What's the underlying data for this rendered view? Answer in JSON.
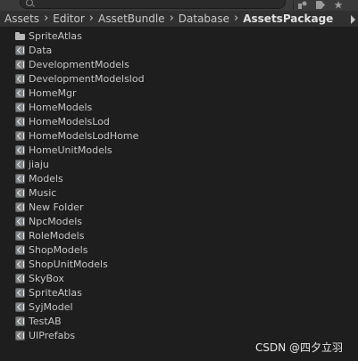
{
  "breadcrumb": {
    "items": [
      "Assets",
      "Editor",
      "AssetBundle",
      "Database",
      "AssetsPackage"
    ],
    "separator": "›"
  },
  "toolbar": {
    "search_placeholder": "",
    "icons": [
      "search-icon",
      "filter-by-type-icon",
      "filter-by-label-icon",
      "favorite-star-icon"
    ]
  },
  "folders": [
    {
      "label": "SpriteAtlas",
      "icon": "folder-icon"
    },
    {
      "label": "Data",
      "icon": "asset-bundle-folder-icon"
    },
    {
      "label": "DevelopmentModels",
      "icon": "asset-bundle-folder-icon"
    },
    {
      "label": "DevelopmentModelslod",
      "icon": "asset-bundle-folder-icon"
    },
    {
      "label": "HomeMgr",
      "icon": "asset-bundle-folder-icon"
    },
    {
      "label": "HomeModels",
      "icon": "asset-bundle-folder-icon"
    },
    {
      "label": "HomeModelsLod",
      "icon": "asset-bundle-folder-icon"
    },
    {
      "label": "HomeModelsLodHome",
      "icon": "asset-bundle-folder-icon"
    },
    {
      "label": "HomeUnitModels",
      "icon": "asset-bundle-folder-icon"
    },
    {
      "label": "jiaju",
      "icon": "asset-bundle-folder-icon"
    },
    {
      "label": "Models",
      "icon": "asset-bundle-folder-icon"
    },
    {
      "label": "Music",
      "icon": "asset-bundle-folder-icon"
    },
    {
      "label": "New Folder",
      "icon": "asset-bundle-folder-icon"
    },
    {
      "label": "NpcModels",
      "icon": "asset-bundle-folder-icon"
    },
    {
      "label": "RoleModels",
      "icon": "asset-bundle-folder-icon"
    },
    {
      "label": "ShopModels",
      "icon": "asset-bundle-folder-icon"
    },
    {
      "label": "ShopUnitModels",
      "icon": "asset-bundle-folder-icon"
    },
    {
      "label": "SkyBox",
      "icon": "asset-bundle-folder-icon"
    },
    {
      "label": "SpriteAtlas",
      "icon": "asset-bundle-folder-icon"
    },
    {
      "label": "SyjModel",
      "icon": "asset-bundle-folder-icon"
    },
    {
      "label": "TestAB",
      "icon": "asset-bundle-folder-icon"
    },
    {
      "label": "UIPrefabs",
      "icon": "asset-bundle-folder-icon"
    }
  ],
  "watermark": "CSDN @四夕立羽"
}
